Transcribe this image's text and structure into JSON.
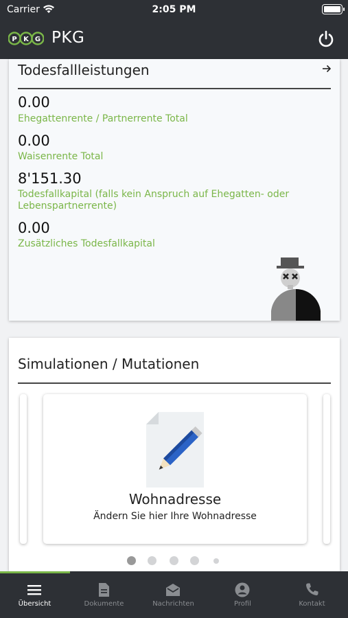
{
  "status_bar": {
    "carrier": "Carrier",
    "time": "2:05 PM"
  },
  "header": {
    "title": "PKG",
    "logo_text": "PKG"
  },
  "death_benefits": {
    "title": "Todesfallleistungen",
    "items": [
      {
        "value": "0.00",
        "label": "Ehegattenrente / Partnerrente Total"
      },
      {
        "value": "0.00",
        "label": "Waisenrente Total"
      },
      {
        "value": "8'151.30",
        "label": "Todesfallkapital (falls kein Anspruch auf Ehegatten- oder Lebenspartnerrente)"
      },
      {
        "value": "0.00",
        "label": "Zusätzliches Todesfallkapital"
      }
    ]
  },
  "simulations": {
    "title": "Simulationen / Mutationen",
    "slide": {
      "title": "Wohnadresse",
      "subtitle": "Ändern Sie hier Ihre Wohnadresse"
    },
    "page_count": 5,
    "active_page": 0
  },
  "tabs": [
    {
      "label": "Übersicht",
      "icon": "menu-icon",
      "active": true
    },
    {
      "label": "Dokumente",
      "icon": "document-icon",
      "active": false
    },
    {
      "label": "Nachrichten",
      "icon": "mail-icon",
      "active": false
    },
    {
      "label": "Profil",
      "icon": "profile-icon",
      "active": false
    },
    {
      "label": "Kontakt",
      "icon": "phone-icon",
      "active": false
    }
  ],
  "colors": {
    "accent": "#7ab648",
    "header_bg": "#2d3035"
  }
}
